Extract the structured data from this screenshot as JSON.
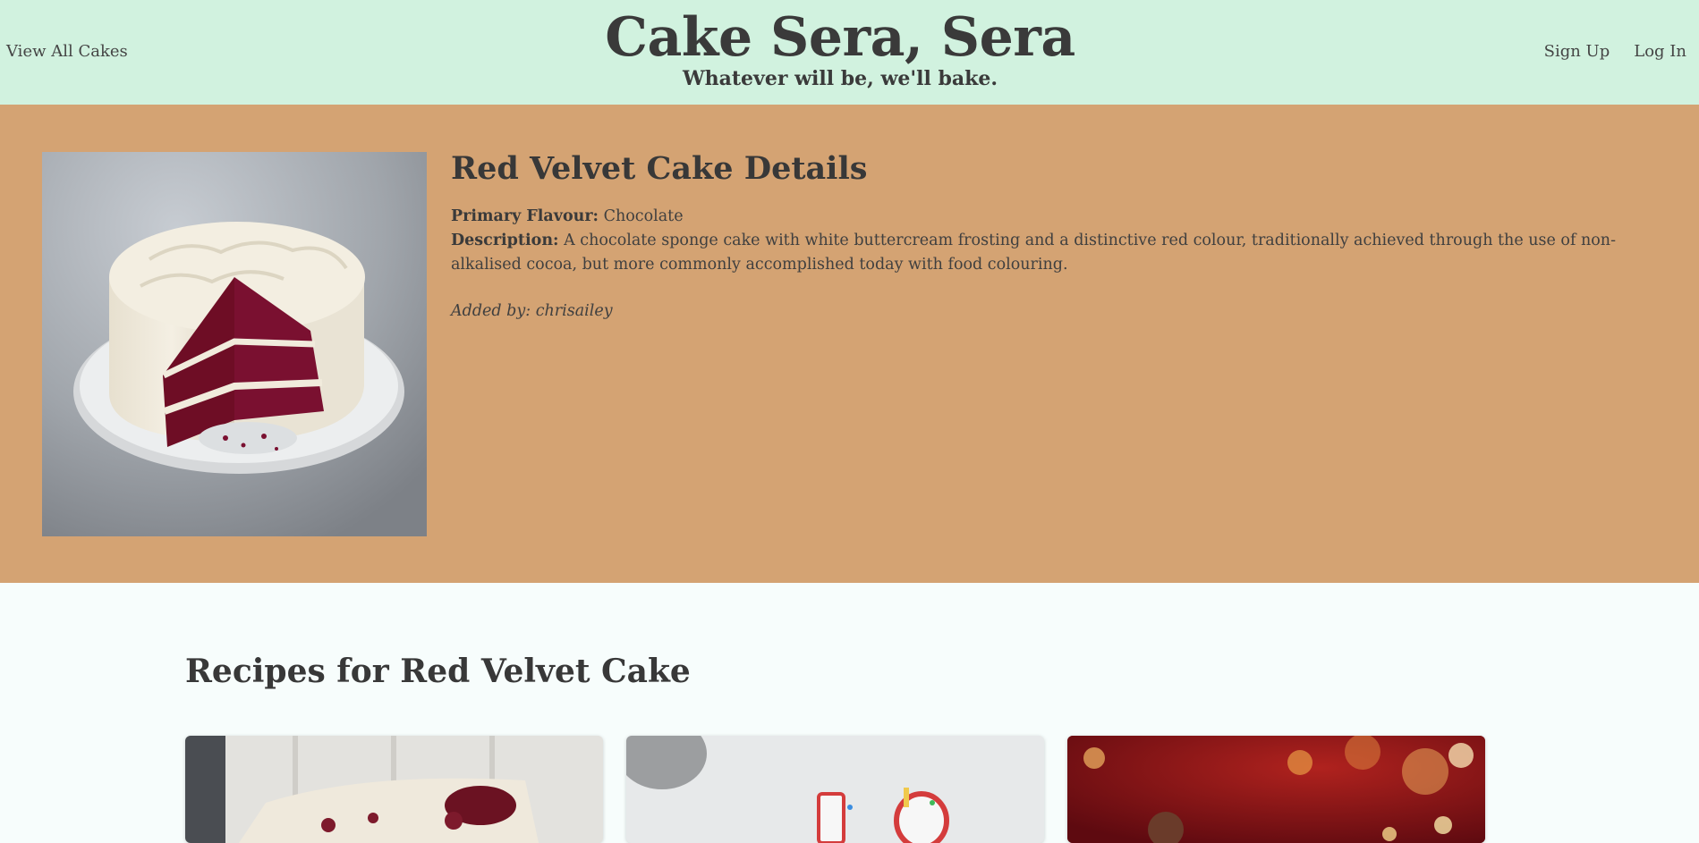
{
  "header": {
    "view_all_label": "View All Cakes",
    "title": "Cake Sera, Sera",
    "tagline": "Whatever will be, we'll bake.",
    "signup_label": "Sign Up",
    "login_label": "Log In"
  },
  "cake": {
    "heading": "Red Velvet Cake Details",
    "flavour_label": "Primary Flavour:",
    "flavour_value": "Chocolate",
    "description_label": "Description:",
    "description_value": "A chocolate sponge cake with white buttercream frosting and a distinctive red colour, traditionally achieved through the use of non-alkalised cocoa, but more commonly accomplished today with food colouring.",
    "added_by": "Added by: chrisailey"
  },
  "recipes": {
    "heading": "Recipes for Red Velvet Cake",
    "cards": [
      {
        "image_icon": "red-velvet-slice-photo"
      },
      {
        "image_icon": "birthday-candles-photo"
      },
      {
        "image_icon": "festive-bokeh-photo"
      }
    ]
  },
  "colors": {
    "header_bg": "#d1f2df",
    "detail_bg": "#d4a373",
    "page_bg": "#f7fdfc",
    "text": "#3f3f3f"
  }
}
